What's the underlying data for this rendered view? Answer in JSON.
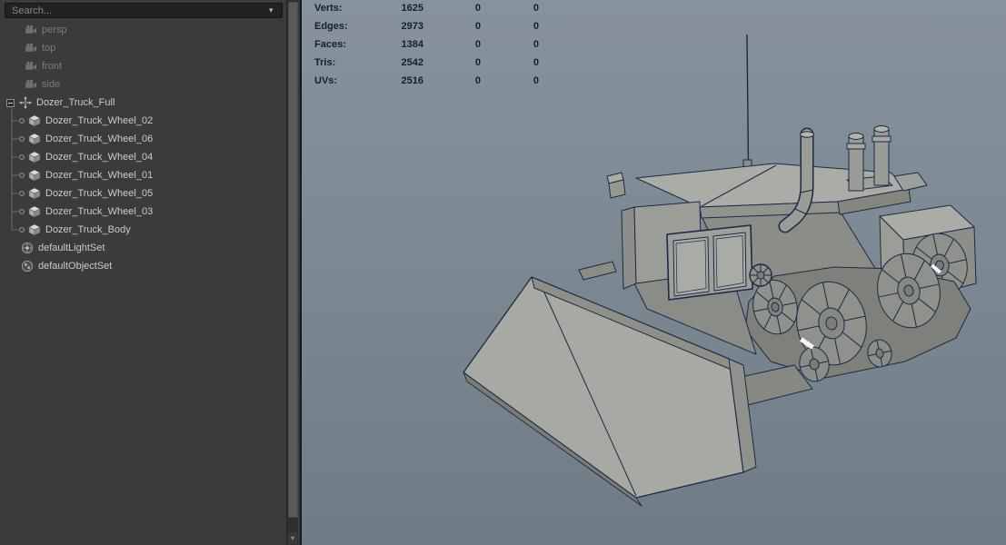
{
  "outliner": {
    "search": {
      "placeholder": "Search..."
    },
    "cameras": [
      {
        "label": "persp"
      },
      {
        "label": "top"
      },
      {
        "label": "front"
      },
      {
        "label": "side"
      }
    ],
    "root": {
      "label": "Dozer_Truck_Full"
    },
    "children": [
      {
        "label": "Dozer_Truck_Wheel_02"
      },
      {
        "label": "Dozer_Truck_Wheel_06"
      },
      {
        "label": "Dozer_Truck_Wheel_04"
      },
      {
        "label": "Dozer_Truck_Wheel_01"
      },
      {
        "label": "Dozer_Truck_Wheel_05"
      },
      {
        "label": "Dozer_Truck_Wheel_03"
      },
      {
        "label": "Dozer_Truck_Body"
      }
    ],
    "sets": [
      {
        "label": "defaultLightSet"
      },
      {
        "label": "defaultObjectSet"
      }
    ]
  },
  "viewport": {
    "hud": {
      "rows": [
        {
          "label": "Verts:",
          "total": "1625",
          "col2": "0",
          "col3": "0"
        },
        {
          "label": "Edges:",
          "total": "2973",
          "col2": "0",
          "col3": "0"
        },
        {
          "label": "Faces:",
          "total": "1384",
          "col2": "0",
          "col3": "0"
        },
        {
          "label": "Tris:",
          "total": "2542",
          "col2": "0",
          "col3": "0"
        },
        {
          "label": "UVs:",
          "total": "2516",
          "col2": "0",
          "col3": "0"
        }
      ]
    }
  },
  "icons": {
    "search_dropdown": "▾",
    "scroll_down": "▾"
  },
  "colors": {
    "panel_bg": "#3b3b3b",
    "viewport_top": "#87929c",
    "viewport_bottom": "#6f7c86",
    "wireframe": "#1d2a47",
    "hud_text": "#151f33",
    "label_dim": "#7c7c7c",
    "label_normal": "#cbcbcb"
  }
}
